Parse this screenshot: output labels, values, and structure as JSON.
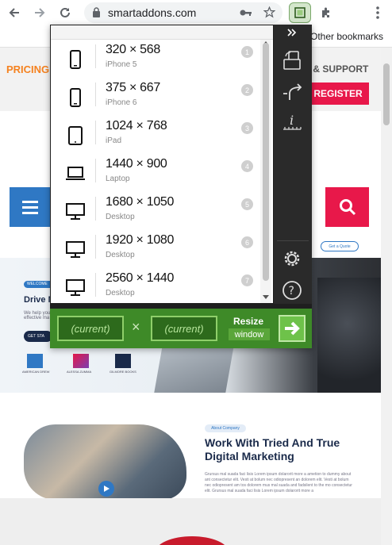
{
  "browser": {
    "url": "smartaddons.com",
    "other_bookmarks": "Other bookmarks"
  },
  "site": {
    "nav_pricing": "PRICING",
    "nav_support": "S & SUPPORT",
    "register": "REGISTER",
    "hero_badge": "WELCOME",
    "hero_title": "Drive M",
    "hero_text": "We help you effective ma",
    "hero_button": "GET STA",
    "quote": "Get a Quote",
    "about_pill": "About Company",
    "about_title": "Work With Tried And True Digital Marketing",
    "about_text": "Grursus mal suada faci lisis Lorem ipsum dolarorit more a ametion to dummy about ant consectetur elit. Vesti at bolum nec odiopresent an dolorem elit. Vesti at bolum nec odiopresent am tos dolorem mus mal suada and fadsilent to the mo consectetur elit. Grursus mal suada faci lisis Lorem ipsum dolarorit more a",
    "logos": [
      "AMERICAN DREW",
      "ALESSA ZUMMA",
      "GILMORE BOOKS"
    ]
  },
  "popup": {
    "presets": [
      {
        "size": "320 × 568",
        "label": "iPhone 5",
        "num": "1",
        "icon": "phone-icon"
      },
      {
        "size": "375 × 667",
        "label": "iPhone 6",
        "num": "2",
        "icon": "phone-icon"
      },
      {
        "size": "1024 × 768",
        "label": "iPad",
        "num": "3",
        "icon": "tablet-icon"
      },
      {
        "size": "1440 × 900",
        "label": "Laptop",
        "num": "4",
        "icon": "laptop-icon"
      },
      {
        "size": "1680 × 1050",
        "label": "Desktop",
        "num": "5",
        "icon": "monitor-icon"
      },
      {
        "size": "1920 × 1080",
        "label": "Desktop",
        "num": "6",
        "icon": "monitor-icon"
      },
      {
        "size": "2560 × 1440",
        "label": "Desktop",
        "num": "7",
        "icon": "monitor-icon"
      }
    ],
    "tools": [
      "expand-arrows-icon",
      "rotate-viewport-icon",
      "export-arrow-icon",
      "info-ruler-icon",
      "settings-gear-icon",
      "help-icon"
    ],
    "width_current": "(current)",
    "times": "×",
    "height_current": "(current)",
    "resize_label": "Resize",
    "window_label": "window"
  },
  "colors": {
    "popup_bg": "#1f1f1f",
    "resize_bar": "#3e8a28",
    "accent_red": "#e8184a",
    "accent_blue": "#2f78c4"
  }
}
